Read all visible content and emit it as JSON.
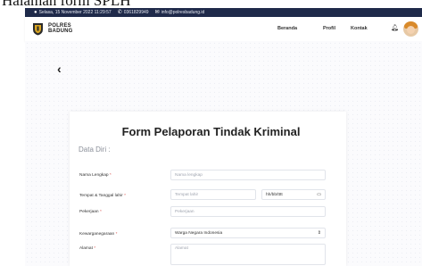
{
  "caption": "Halaman form SPLH",
  "topbar": {
    "datetime": "Selasa, 15 November 2022 11:29:57",
    "phone": "0361829949",
    "email": "info@polresbadung.id"
  },
  "navbar": {
    "brand_line1": "POLRES",
    "brand_line2": "BADUNG",
    "links": [
      "Beranda",
      "Profil",
      "Kontak"
    ]
  },
  "form": {
    "title": "Form Pelaporan Tindak Kriminal",
    "section": "Data Diri :",
    "fields": [
      {
        "label": "Nama Lengkap",
        "placeholder": "Nama lengkap"
      },
      {
        "label": "Tempat & Tanggal lahir",
        "placeholder": "Tempat lahir",
        "date_placeholder": "hh/bb/tttt"
      },
      {
        "label": "Pekerjaan",
        "placeholder": "Pekerjaan"
      },
      {
        "label": "Kewarganegaraan",
        "value": "Warga Negara Indonesia"
      },
      {
        "label": "Alamat",
        "placeholder": "Alamat"
      }
    ],
    "required_mark": "*"
  },
  "colors": {
    "topbar_bg": "#1f2a4a",
    "required": "#d9534f"
  }
}
